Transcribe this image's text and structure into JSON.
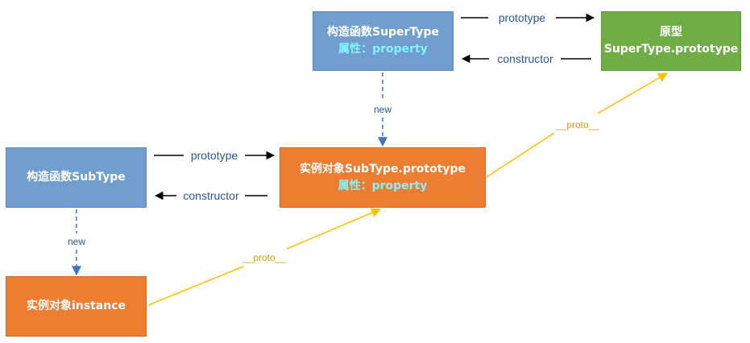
{
  "boxes": {
    "supertype": {
      "line1": "构造函数SuperType",
      "line2": "属性：property"
    },
    "prototype_obj": {
      "line1": "原型",
      "line2": "SuperType.prototype"
    },
    "subtype": {
      "line1": "构造函数SubType"
    },
    "subtype_prototype": {
      "line1": "实例对象SubType.prototype",
      "line2": "属性：property"
    },
    "instance": {
      "line1": "实例对象instance"
    }
  },
  "edges": {
    "prototype_label": "prototype",
    "constructor_label": "constructor",
    "new_label": "new",
    "proto_label": "__proto__"
  },
  "colors": {
    "blue_box": "#729ecf",
    "orange_box": "#ed7d31",
    "green_box": "#70ad47",
    "property_text": "#7ff5ff",
    "edge_label": "#2f5597",
    "dashed_arrow": "#4472c4",
    "proto_arrow": "#ffc000",
    "proto_label": "#c9a100"
  }
}
